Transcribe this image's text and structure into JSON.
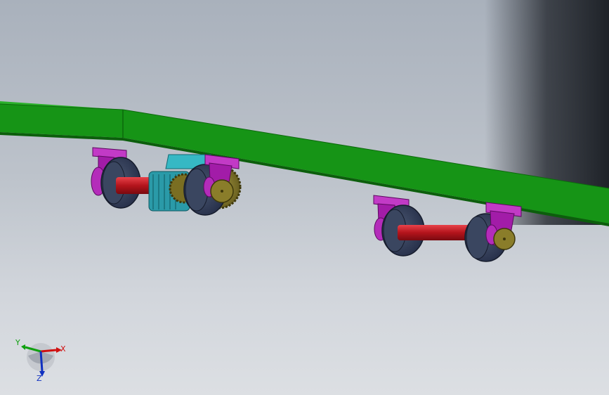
{
  "viewport": {
    "background_top": "#a9b1bc",
    "background_bottom": "#dcdfe3"
  },
  "colors": {
    "platform": "#159215",
    "platform_dark": "#0d6a0d",
    "bracket": "#a21ca8",
    "axle": "#c8141c",
    "wheel": "#3a4660",
    "gear": "#8a7d2a",
    "motor": "#2aa6b4"
  },
  "triad": {
    "x_label": "X",
    "y_label": "Y",
    "z_label": "Z",
    "x_color": "#d01010",
    "y_color": "#10a010",
    "z_color": "#1030c0"
  }
}
